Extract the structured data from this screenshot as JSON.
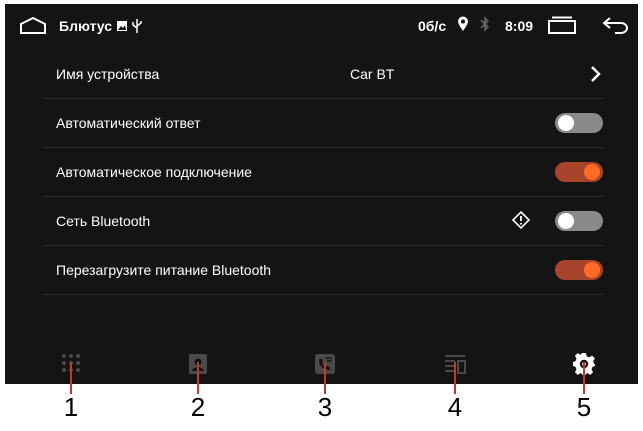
{
  "statusbar": {
    "title": "Блютус",
    "speed": "0б/с",
    "time": "8:09"
  },
  "settings": [
    {
      "label": "Имя устройства",
      "value": "Car BT",
      "control": "chevron"
    },
    {
      "label": "Автоматический ответ",
      "control": "toggle",
      "state": "off"
    },
    {
      "label": "Автоматическое подключение",
      "control": "toggle",
      "state": "on"
    },
    {
      "label": "Сеть Bluetooth",
      "control": "toggle",
      "state": "off",
      "warning": true
    },
    {
      "label": "Перезагрузите питание Bluetooth",
      "control": "toggle",
      "state": "on"
    }
  ],
  "navbar": {
    "items": [
      "keypad-icon",
      "contacts-icon",
      "call-log-icon",
      "music-icon",
      "settings-icon"
    ],
    "active_index": 4
  },
  "callouts": [
    "1",
    "2",
    "3",
    "4",
    "5"
  ],
  "colors": {
    "background": "#141414",
    "toggle_on_track": "#a8442c",
    "toggle_on_knob": "#ff6a26",
    "toggle_off_track": "#8a8a8a",
    "icon_inactive": "#4a4a4a",
    "callout_line": "#c0392b"
  }
}
